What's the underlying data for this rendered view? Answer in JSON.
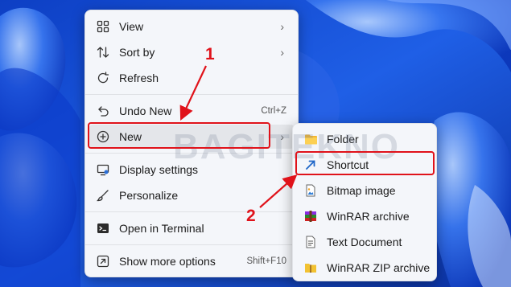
{
  "context_menu": {
    "items": [
      {
        "label": "View",
        "shortcut": "",
        "icon": "view-grid-icon",
        "has_submenu": true
      },
      {
        "label": "Sort by",
        "shortcut": "",
        "icon": "sort-icon",
        "has_submenu": true
      },
      {
        "label": "Refresh",
        "shortcut": "",
        "icon": "refresh-icon",
        "has_submenu": false
      },
      {
        "label": "Undo New",
        "shortcut": "Ctrl+Z",
        "icon": "undo-icon",
        "has_submenu": false
      },
      {
        "label": "New",
        "shortcut": "",
        "icon": "add-circle-icon",
        "has_submenu": true
      },
      {
        "label": "Display settings",
        "shortcut": "",
        "icon": "display-icon",
        "has_submenu": false
      },
      {
        "label": "Personalize",
        "shortcut": "",
        "icon": "brush-icon",
        "has_submenu": false
      },
      {
        "label": "Open in Terminal",
        "shortcut": "",
        "icon": "terminal-icon",
        "has_submenu": false
      },
      {
        "label": "Show more options",
        "shortcut": "Shift+F10",
        "icon": "show-more-icon",
        "has_submenu": false
      }
    ]
  },
  "new_submenu": {
    "items": [
      {
        "label": "Folder",
        "icon": "folder-icon"
      },
      {
        "label": "Shortcut",
        "icon": "shortcut-arrow-icon"
      },
      {
        "label": "Bitmap image",
        "icon": "bitmap-icon"
      },
      {
        "label": "WinRAR archive",
        "icon": "winrar-icon"
      },
      {
        "label": "Text Document",
        "icon": "text-document-icon"
      },
      {
        "label": "WinRAR ZIP archive",
        "icon": "winrar-zip-icon"
      }
    ]
  },
  "annotations": {
    "step1": "1",
    "step2": "2",
    "watermark": "BAGITEKNO"
  },
  "colors": {
    "annotation_red": "#e0121a",
    "wallpaper_blue": "#1a4fd6",
    "menu_bg": "#f4f6fa"
  }
}
